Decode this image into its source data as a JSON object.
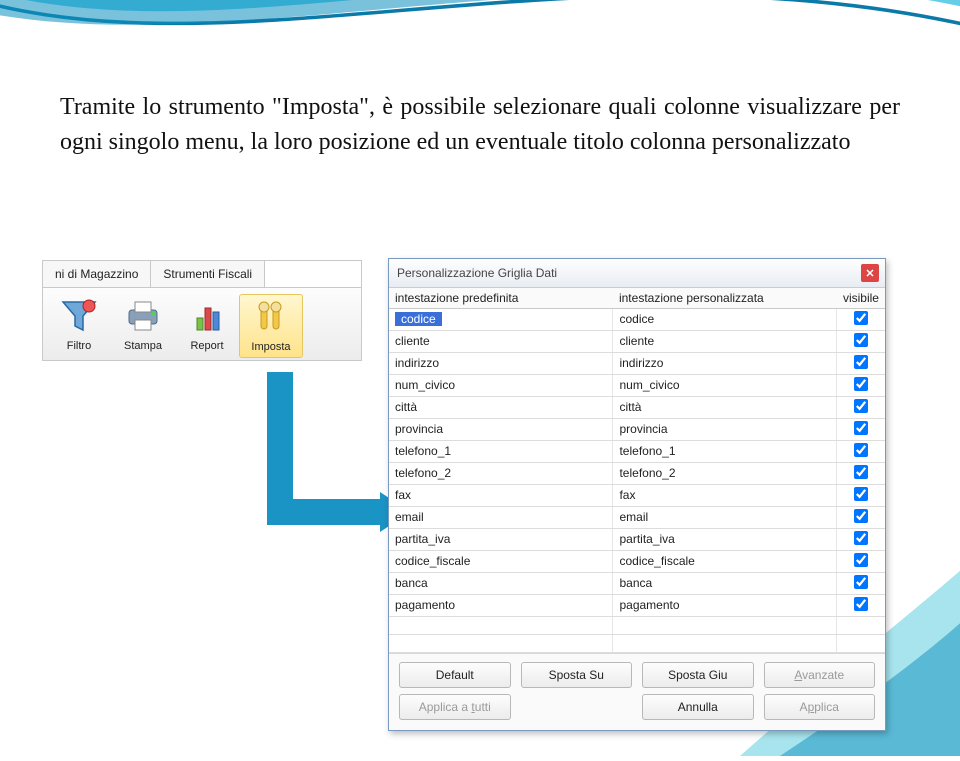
{
  "text": "Tramite lo strumento \"Imposta\", è possibile selezionare quali colonne visualizzare per ogni singolo menu, la loro posizione ed un eventuale titolo colonna personalizzato",
  "toolbar": {
    "tabs": [
      "ni di Magazzino",
      "Strumenti Fiscali"
    ],
    "buttons": [
      {
        "label": "Filtro",
        "icon": "filtro-icon",
        "selected": false
      },
      {
        "label": "Stampa",
        "icon": "stampa-icon",
        "selected": false
      },
      {
        "label": "Report",
        "icon": "report-icon",
        "selected": false
      },
      {
        "label": "Imposta",
        "icon": "imposta-icon",
        "selected": true
      }
    ]
  },
  "dialog": {
    "title": "Personalizzazione Griglia Dati",
    "headers": [
      "intestazione predefinita",
      "intestazione personalizzata",
      "visibile"
    ],
    "rows": [
      {
        "predef": "codice",
        "pers": "codice",
        "vis": true,
        "selected": true
      },
      {
        "predef": "cliente",
        "pers": "cliente",
        "vis": true
      },
      {
        "predef": "indirizzo",
        "pers": "indirizzo",
        "vis": true
      },
      {
        "predef": "num_civico",
        "pers": "num_civico",
        "vis": true
      },
      {
        "predef": "città",
        "pers": "città",
        "vis": true
      },
      {
        "predef": "provincia",
        "pers": "provincia",
        "vis": true
      },
      {
        "predef": "telefono_1",
        "pers": "telefono_1",
        "vis": true
      },
      {
        "predef": "telefono_2",
        "pers": "telefono_2",
        "vis": true
      },
      {
        "predef": "fax",
        "pers": "fax",
        "vis": true
      },
      {
        "predef": "email",
        "pers": "email",
        "vis": true
      },
      {
        "predef": "partita_iva",
        "pers": "partita_iva",
        "vis": true
      },
      {
        "predef": "codice_fiscale",
        "pers": "codice_fiscale",
        "vis": true
      },
      {
        "predef": "banca",
        "pers": "banca",
        "vis": true
      },
      {
        "predef": "pagamento",
        "pers": "pagamento",
        "vis": true
      }
    ],
    "buttons": {
      "default": "Default",
      "sposta_su": "Sposta Su",
      "sposta_giu": "Sposta Giu",
      "avanzate": "Avanzate",
      "applica_tutti": "Applica a tutti",
      "annulla": "Annulla",
      "applica": "Applica"
    }
  }
}
